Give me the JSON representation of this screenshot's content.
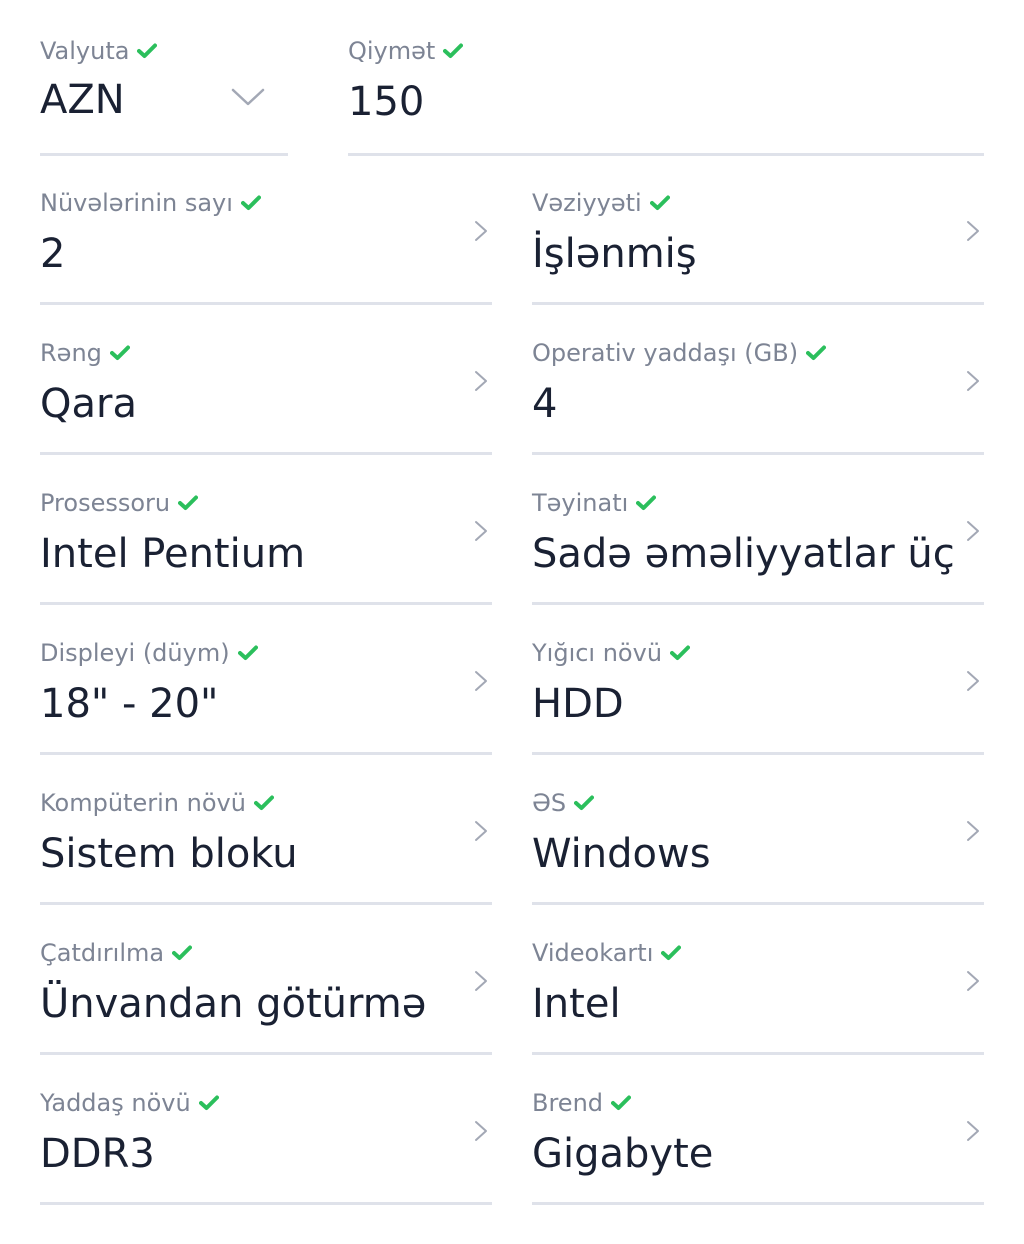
{
  "currency": {
    "label": "Valyuta",
    "value": "AZN",
    "icon": "chevron-down-icon"
  },
  "price": {
    "label": "Qiymət",
    "value": "150"
  },
  "fields": [
    {
      "label": "Nüvələrinin sayı",
      "value": "2"
    },
    {
      "label": "Vəziyyəti",
      "value": "İşlənmiş"
    },
    {
      "label": "Rəng",
      "value": "Qara"
    },
    {
      "label": "Operativ yaddaşı (GB)",
      "value": "4"
    },
    {
      "label": "Prosessoru",
      "value": "Intel Pentium"
    },
    {
      "label": "Təyinatı",
      "value": "Sadə əməliyyatlar üçü"
    },
    {
      "label": "Displeyi (düym)",
      "value": "18\" - 20\""
    },
    {
      "label": "Yığıcı növü",
      "value": "HDD"
    },
    {
      "label": "Kompüterin növü",
      "value": "Sistem bloku"
    },
    {
      "label": "ƏS",
      "value": "Windows"
    },
    {
      "label": "Çatdırılma",
      "value": "Ünvandan götürmə"
    },
    {
      "label": "Videokartı",
      "value": "Intel"
    },
    {
      "label": "Yaddaş növü",
      "value": "DDR3"
    },
    {
      "label": "Brend",
      "value": "Gigabyte"
    }
  ],
  "colors": {
    "check": "#2bbf5c",
    "label": "#7d8494",
    "value": "#1a2133",
    "divider": "#dfe2ea",
    "chevron": "#a3a8b5"
  }
}
